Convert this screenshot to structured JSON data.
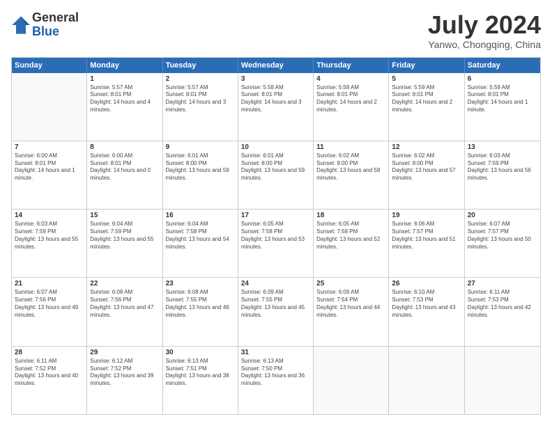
{
  "logo": {
    "general": "General",
    "blue": "Blue"
  },
  "title": "July 2024",
  "location": "Yanwo, Chongqing, China",
  "header_days": [
    "Sunday",
    "Monday",
    "Tuesday",
    "Wednesday",
    "Thursday",
    "Friday",
    "Saturday"
  ],
  "weeks": [
    [
      {
        "day": "",
        "sunrise": "",
        "sunset": "",
        "daylight": ""
      },
      {
        "day": "1",
        "sunrise": "Sunrise: 5:57 AM",
        "sunset": "Sunset: 8:01 PM",
        "daylight": "Daylight: 14 hours and 4 minutes."
      },
      {
        "day": "2",
        "sunrise": "Sunrise: 5:57 AM",
        "sunset": "Sunset: 8:01 PM",
        "daylight": "Daylight: 14 hours and 3 minutes."
      },
      {
        "day": "3",
        "sunrise": "Sunrise: 5:58 AM",
        "sunset": "Sunset: 8:01 PM",
        "daylight": "Daylight: 14 hours and 3 minutes."
      },
      {
        "day": "4",
        "sunrise": "Sunrise: 5:58 AM",
        "sunset": "Sunset: 8:01 PM",
        "daylight": "Daylight: 14 hours and 2 minutes."
      },
      {
        "day": "5",
        "sunrise": "Sunrise: 5:59 AM",
        "sunset": "Sunset: 8:01 PM",
        "daylight": "Daylight: 14 hours and 2 minutes."
      },
      {
        "day": "6",
        "sunrise": "Sunrise: 5:59 AM",
        "sunset": "Sunset: 8:01 PM",
        "daylight": "Daylight: 14 hours and 1 minute."
      }
    ],
    [
      {
        "day": "7",
        "sunrise": "Sunrise: 6:00 AM",
        "sunset": "Sunset: 8:01 PM",
        "daylight": "Daylight: 14 hours and 1 minute."
      },
      {
        "day": "8",
        "sunrise": "Sunrise: 6:00 AM",
        "sunset": "Sunset: 8:01 PM",
        "daylight": "Daylight: 14 hours and 0 minutes."
      },
      {
        "day": "9",
        "sunrise": "Sunrise: 6:01 AM",
        "sunset": "Sunset: 8:00 PM",
        "daylight": "Daylight: 13 hours and 59 minutes."
      },
      {
        "day": "10",
        "sunrise": "Sunrise: 6:01 AM",
        "sunset": "Sunset: 8:00 PM",
        "daylight": "Daylight: 13 hours and 59 minutes."
      },
      {
        "day": "11",
        "sunrise": "Sunrise: 6:02 AM",
        "sunset": "Sunset: 8:00 PM",
        "daylight": "Daylight: 13 hours and 58 minutes."
      },
      {
        "day": "12",
        "sunrise": "Sunrise: 6:02 AM",
        "sunset": "Sunset: 8:00 PM",
        "daylight": "Daylight: 13 hours and 57 minutes."
      },
      {
        "day": "13",
        "sunrise": "Sunrise: 6:03 AM",
        "sunset": "Sunset: 7:59 PM",
        "daylight": "Daylight: 13 hours and 56 minutes."
      }
    ],
    [
      {
        "day": "14",
        "sunrise": "Sunrise: 6:03 AM",
        "sunset": "Sunset: 7:59 PM",
        "daylight": "Daylight: 13 hours and 55 minutes."
      },
      {
        "day": "15",
        "sunrise": "Sunrise: 6:04 AM",
        "sunset": "Sunset: 7:59 PM",
        "daylight": "Daylight: 13 hours and 55 minutes."
      },
      {
        "day": "16",
        "sunrise": "Sunrise: 6:04 AM",
        "sunset": "Sunset: 7:58 PM",
        "daylight": "Daylight: 13 hours and 54 minutes."
      },
      {
        "day": "17",
        "sunrise": "Sunrise: 6:05 AM",
        "sunset": "Sunset: 7:58 PM",
        "daylight": "Daylight: 13 hours and 53 minutes."
      },
      {
        "day": "18",
        "sunrise": "Sunrise: 6:05 AM",
        "sunset": "Sunset: 7:58 PM",
        "daylight": "Daylight: 13 hours and 52 minutes."
      },
      {
        "day": "19",
        "sunrise": "Sunrise: 6:06 AM",
        "sunset": "Sunset: 7:57 PM",
        "daylight": "Daylight: 13 hours and 51 minutes."
      },
      {
        "day": "20",
        "sunrise": "Sunrise: 6:07 AM",
        "sunset": "Sunset: 7:57 PM",
        "daylight": "Daylight: 13 hours and 50 minutes."
      }
    ],
    [
      {
        "day": "21",
        "sunrise": "Sunrise: 6:07 AM",
        "sunset": "Sunset: 7:56 PM",
        "daylight": "Daylight: 13 hours and 49 minutes."
      },
      {
        "day": "22",
        "sunrise": "Sunrise: 6:08 AM",
        "sunset": "Sunset: 7:56 PM",
        "daylight": "Daylight: 13 hours and 47 minutes."
      },
      {
        "day": "23",
        "sunrise": "Sunrise: 6:08 AM",
        "sunset": "Sunset: 7:55 PM",
        "daylight": "Daylight: 13 hours and 46 minutes."
      },
      {
        "day": "24",
        "sunrise": "Sunrise: 6:09 AM",
        "sunset": "Sunset: 7:55 PM",
        "daylight": "Daylight: 13 hours and 45 minutes."
      },
      {
        "day": "25",
        "sunrise": "Sunrise: 6:09 AM",
        "sunset": "Sunset: 7:54 PM",
        "daylight": "Daylight: 13 hours and 44 minutes."
      },
      {
        "day": "26",
        "sunrise": "Sunrise: 6:10 AM",
        "sunset": "Sunset: 7:53 PM",
        "daylight": "Daylight: 13 hours and 43 minutes."
      },
      {
        "day": "27",
        "sunrise": "Sunrise: 6:11 AM",
        "sunset": "Sunset: 7:53 PM",
        "daylight": "Daylight: 13 hours and 42 minutes."
      }
    ],
    [
      {
        "day": "28",
        "sunrise": "Sunrise: 6:11 AM",
        "sunset": "Sunset: 7:52 PM",
        "daylight": "Daylight: 13 hours and 40 minutes."
      },
      {
        "day": "29",
        "sunrise": "Sunrise: 6:12 AM",
        "sunset": "Sunset: 7:52 PM",
        "daylight": "Daylight: 13 hours and 39 minutes."
      },
      {
        "day": "30",
        "sunrise": "Sunrise: 6:13 AM",
        "sunset": "Sunset: 7:51 PM",
        "daylight": "Daylight: 13 hours and 38 minutes."
      },
      {
        "day": "31",
        "sunrise": "Sunrise: 6:13 AM",
        "sunset": "Sunset: 7:50 PM",
        "daylight": "Daylight: 13 hours and 36 minutes."
      },
      {
        "day": "",
        "sunrise": "",
        "sunset": "",
        "daylight": ""
      },
      {
        "day": "",
        "sunrise": "",
        "sunset": "",
        "daylight": ""
      },
      {
        "day": "",
        "sunrise": "",
        "sunset": "",
        "daylight": ""
      }
    ]
  ]
}
